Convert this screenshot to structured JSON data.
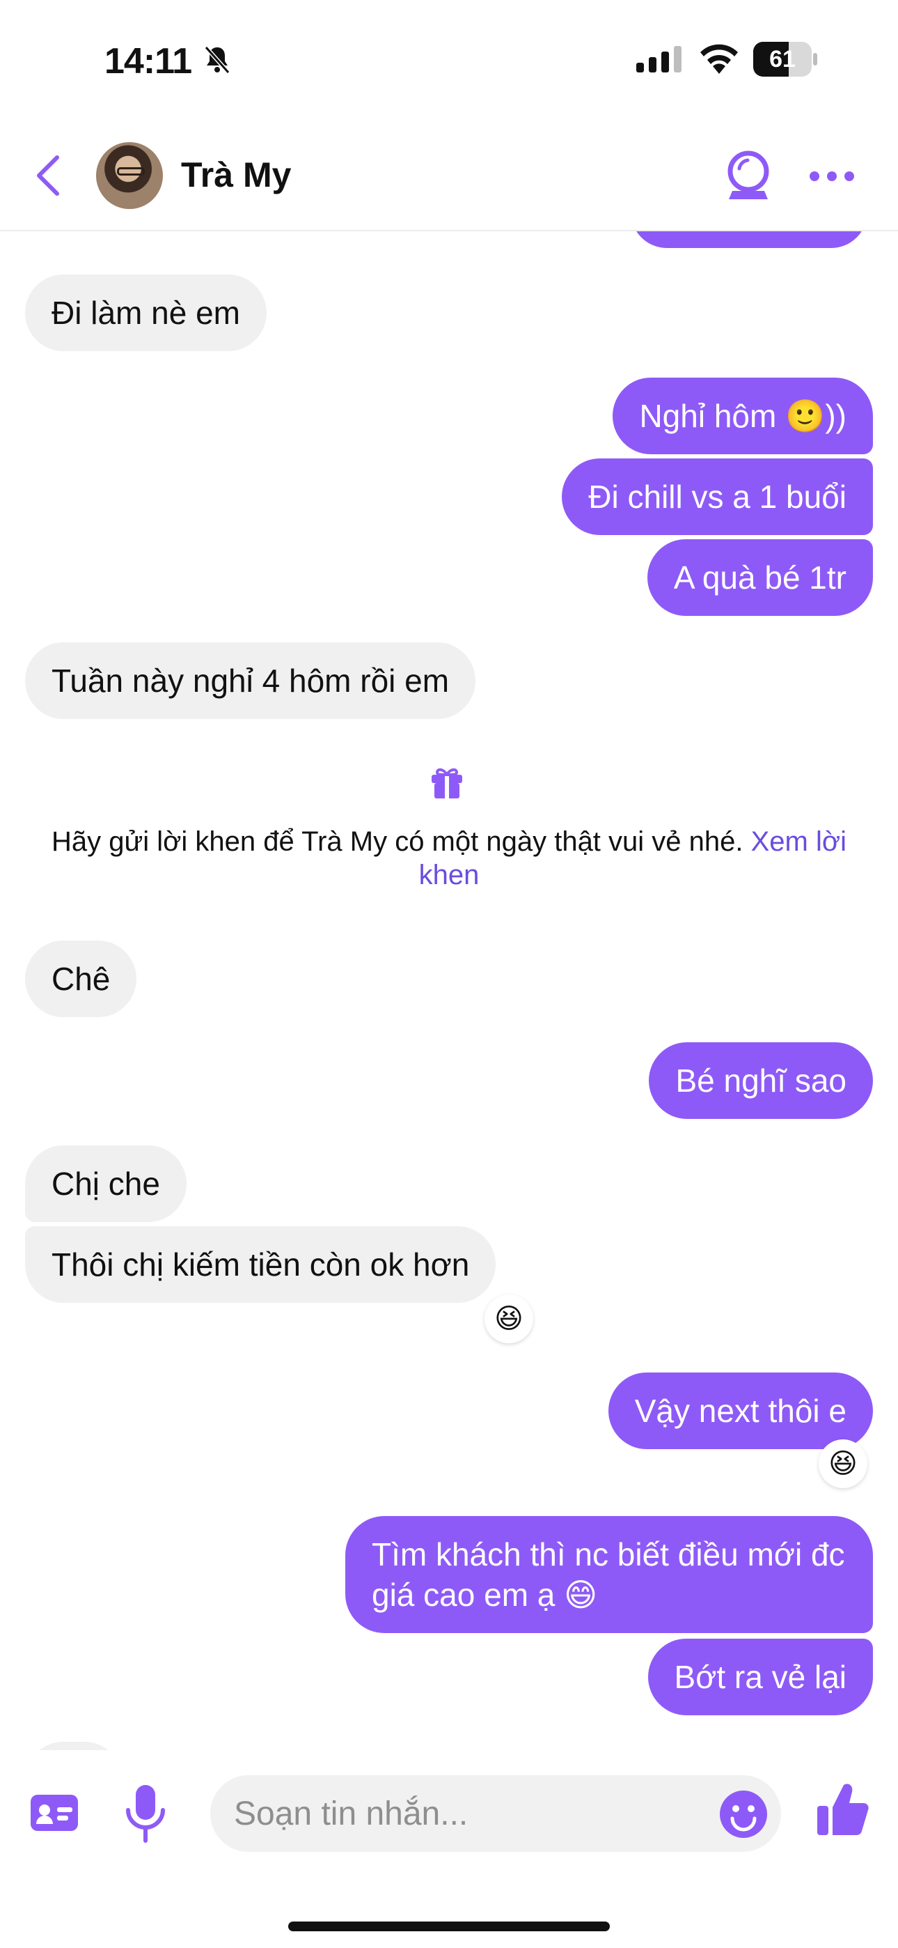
{
  "status_bar": {
    "time": "14:11",
    "battery": "61",
    "battery_level": 0.61
  },
  "header": {
    "contact_name": "Trà My"
  },
  "messages": [
    {
      "id": "m1",
      "text": "Đi làm nè em"
    },
    {
      "id": "m2",
      "text": "Nghỉ hôm 🙂))"
    },
    {
      "id": "m3",
      "text": "Đi chill vs a 1 buổi"
    },
    {
      "id": "m4",
      "text": "A quà bé 1tr"
    },
    {
      "id": "m5",
      "text": "Tuần này nghỉ 4 hôm rồi em"
    },
    {
      "id": "m6",
      "text": "Chê"
    },
    {
      "id": "m7",
      "text": "Bé nghĩ sao"
    },
    {
      "id": "m8",
      "text": "Chị che"
    },
    {
      "id": "m9",
      "text": "Thôi chị kiếm tiền còn ok hơn",
      "reaction": "😆"
    },
    {
      "id": "m10",
      "text": "Vậy next thôi e",
      "reaction": "😆"
    },
    {
      "id": "m11",
      "text": "Tìm khách thì nc biết điều mới đc giá cao em ạ 😄"
    },
    {
      "id": "m12",
      "text": "Bớt ra vẻ lại"
    }
  ],
  "system_notice": {
    "text": "Hãy gửi lời khen để Trà My có một ngày thật vui vẻ nhé. ",
    "link": "Xem lời khen",
    "icon": "gift-icon"
  },
  "composer": {
    "placeholder": "Soạn tin nhắn..."
  },
  "colors": {
    "accent": "#8E5AF7",
    "incoming_bubble": "#F0F0F0"
  },
  "icons": [
    "back-chevron-icon",
    "crystal-ball-icon",
    "more-icon",
    "contact-card-icon",
    "microphone-icon",
    "emoji-icon",
    "thumbs-up-icon"
  ]
}
